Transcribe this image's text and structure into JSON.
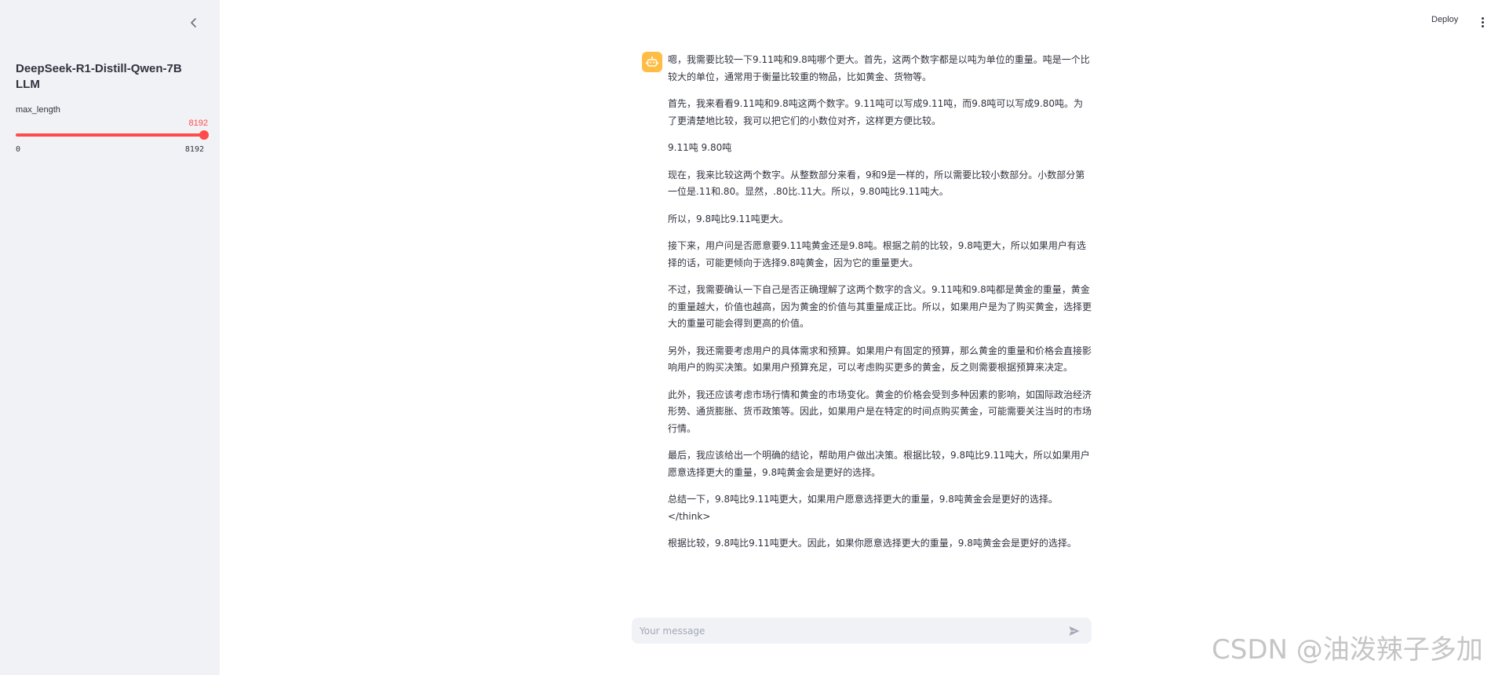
{
  "sidebar": {
    "title_line1": "DeepSeek-R1-Distill-Qwen-7B",
    "title_line2": "LLM",
    "slider": {
      "label": "max_length",
      "value": 8192,
      "value_text": "8192",
      "min": 0,
      "max": 8192,
      "min_text": "0",
      "max_text": "8192"
    }
  },
  "header": {
    "deploy_label": "Deploy"
  },
  "chat": {
    "paragraphs": [
      "嗯，我需要比较一下9.11吨和9.8吨哪个更大。首先，这两个数字都是以吨为单位的重量。吨是一个比较大的单位，通常用于衡量比较重的物品，比如黄金、货物等。",
      "首先，我来看看9.11吨和9.8吨这两个数字。9.11吨可以写成9.11吨，而9.8吨可以写成9.80吨。为了更清楚地比较，我可以把它们的小数位对齐，这样更方便比较。",
      "9.11吨 9.80吨",
      "现在，我来比较这两个数字。从整数部分来看，9和9是一样的，所以需要比较小数部分。小数部分第一位是.11和.80。显然，.80比.11大。所以，9.80吨比9.11吨大。",
      "所以，9.8吨比9.11吨更大。",
      "接下来，用户问是否愿意要9.11吨黄金还是9.8吨。根据之前的比较，9.8吨更大，所以如果用户有选择的话，可能更倾向于选择9.8吨黄金，因为它的重量更大。",
      "不过，我需要确认一下自己是否正确理解了这两个数字的含义。9.11吨和9.8吨都是黄金的重量，黄金的重量越大，价值也越高，因为黄金的价值与其重量成正比。所以，如果用户是为了购买黄金，选择更大的重量可能会得到更高的价值。",
      "另外，我还需要考虑用户的具体需求和预算。如果用户有固定的预算，那么黄金的重量和价格会直接影响用户的购买决策。如果用户预算充足，可以考虑购买更多的黄金，反之则需要根据预算来决定。",
      "此外，我还应该考虑市场行情和黄金的市场变化。黄金的价格会受到多种因素的影响，如国际政治经济形势、通货膨胀、货币政策等。因此，如果用户是在特定的时间点购买黄金，可能需要关注当时的市场行情。",
      "最后，我应该给出一个明确的结论，帮助用户做出决策。根据比较，9.8吨比9.11吨大，所以如果用户愿意选择更大的重量，9.8吨黄金会是更好的选择。",
      "总结一下，9.8吨比9.11吨更大，如果用户愿意选择更大的重量，9.8吨黄金会是更好的选择。\n</think>",
      "根据比较，9.8吨比9.11吨更大。因此，如果你愿意选择更大的重量，9.8吨黄金会是更好的选择。"
    ],
    "input_placeholder": "Your message"
  },
  "watermark": "CSDN @油泼辣子多加",
  "colors": {
    "accent": "#ff4b4b",
    "sidebar_bg": "#f0f2f6",
    "avatar_bg": "#ffbd45",
    "text": "#31333f"
  },
  "icons": {
    "collapse": "chevron-left-icon",
    "avatar": "bot-icon",
    "menu": "more-vertical-icon",
    "send": "send-icon"
  }
}
